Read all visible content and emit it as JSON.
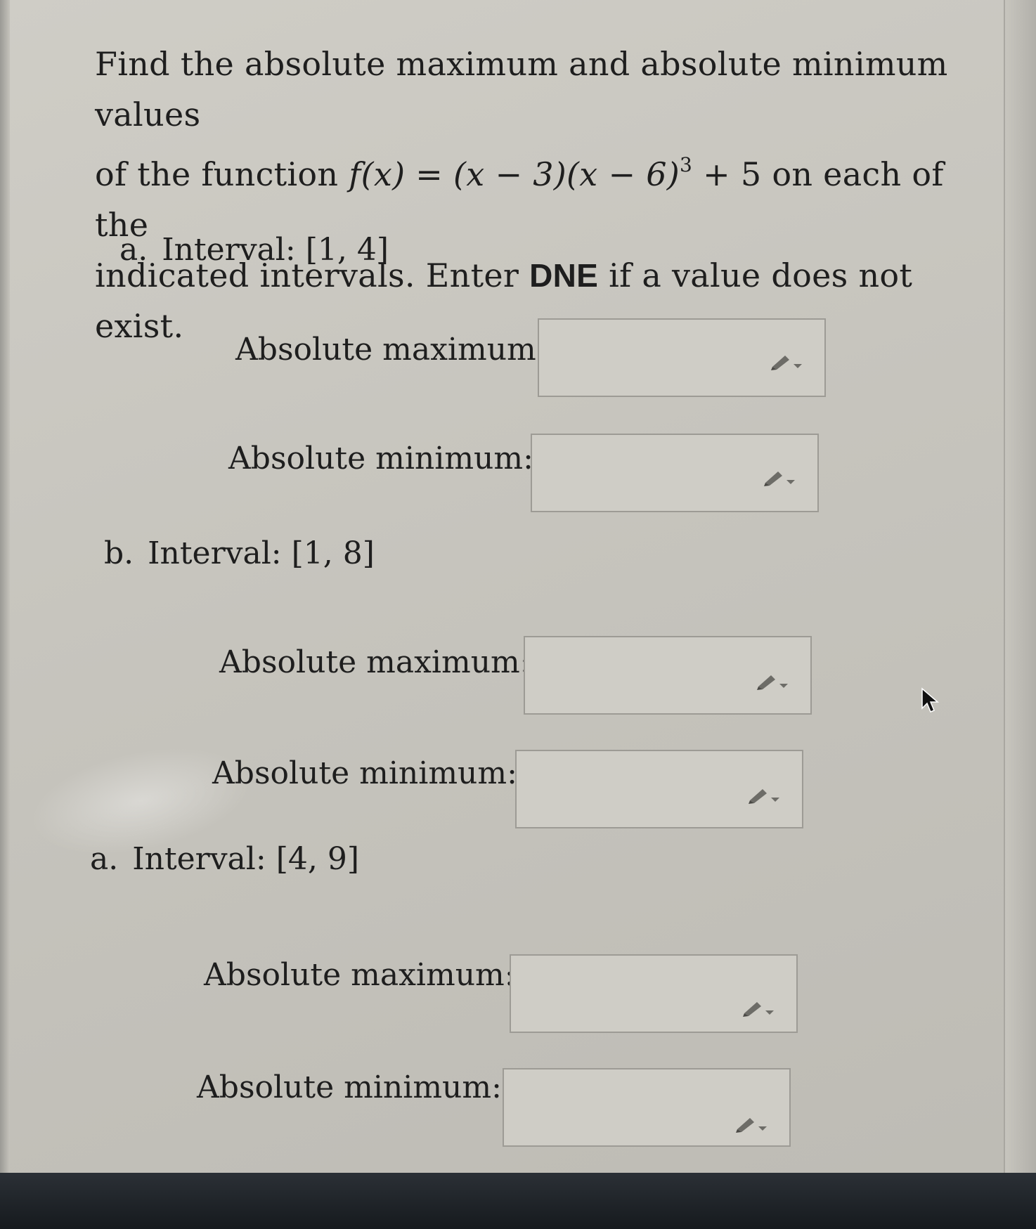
{
  "question": {
    "line1": "Find the absolute maximum and absolute minimum values",
    "line2_prefix": "of the function ",
    "func_f": "f",
    "func_arg": "(x)",
    "func_eq": " = (x − 3)(x − 6)",
    "func_exp": "3",
    "func_tail": " + 5",
    "line2_suffix": " on each of the",
    "line3_prefix": "indicated intervals. Enter ",
    "dne": "DNE",
    "line3_suffix": " if a value does not exist."
  },
  "parts": [
    {
      "letter": "a.",
      "interval_label": "Interval:",
      "interval": "[1, 4]",
      "max_label": "Absolute maximum:",
      "min_label": "Absolute minimum:",
      "max_value": "",
      "min_value": ""
    },
    {
      "letter": "b.",
      "interval_label": "Interval:",
      "interval": "[1, 8]",
      "max_label": "Absolute maximum:",
      "min_label": "Absolute minimum:",
      "max_value": "",
      "min_value": ""
    },
    {
      "letter": "a.",
      "interval_label": "Interval:",
      "interval": "[4, 9]",
      "max_label": "Absolute maximum:",
      "min_label": "Absolute minimum:",
      "max_value": "",
      "min_value": ""
    }
  ],
  "icons": {
    "answer_tool": "pencil-dropdown-icon",
    "pointer": "mouse-cursor-icon"
  },
  "colors": {
    "background": "#c9c7c0",
    "text": "#1e1e1e",
    "box_border": "#9d9b95"
  }
}
